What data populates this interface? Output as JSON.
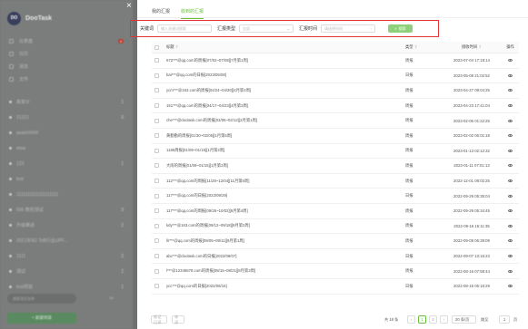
{
  "sidebar": {
    "logo": "DO",
    "title": "DooTask",
    "menu": [
      {
        "label": "仪表盘",
        "badge": "4"
      },
      {
        "label": "日历"
      },
      {
        "label": "消息"
      },
      {
        "label": "文件"
      }
    ],
    "projects": [
      {
        "label": "哀家计",
        "count": "1"
      },
      {
        "label": "21321",
        "count": "0"
      },
      {
        "label": "asas#####",
        "count": ""
      },
      {
        "label": "wwa",
        "count": ""
      },
      {
        "label": "123",
        "count": "1"
      },
      {
        "label": "test",
        "count": ""
      },
      {
        "label": "1111111111111111111",
        "count": ""
      },
      {
        "label": "006 数控测试",
        "count": "3"
      },
      {
        "label": "升级推进",
        "count": "2"
      },
      {
        "label": "2021年5G ToB行业UPF...",
        "count": ""
      },
      {
        "label": "1111",
        "count": "2"
      },
      {
        "label": "测试",
        "count": "2"
      },
      {
        "label": "test项目",
        "count": "1"
      }
    ],
    "search_placeholder": "搜索项目名称",
    "search_count": "13",
    "new_project": "+ 新建项目"
  },
  "close_icon": "×",
  "tabs": [
    {
      "label": "我的汇报",
      "active": false
    },
    {
      "label": "收到的汇报",
      "active": true
    }
  ],
  "filter": {
    "keyword_label": "关键词",
    "keyword_placeholder": "输入关键词搜索",
    "type_label": "汇报类型",
    "type_value": "全部",
    "time_label": "汇报时间",
    "time_placeholder": "请选择时间",
    "search_button": "搜索",
    "accent_color": "#67c23a",
    "highlight_color": "#e23434"
  },
  "table": {
    "headers": {
      "title": "标题",
      "type": "类型",
      "time": "接收时间",
      "op": "操作"
    },
    "rows": [
      {
        "title": "672***@qq.com的周报[07/02~07/08][7月第1周]",
        "type": "周报",
        "time": "2023-07-04 17:18:14"
      },
      {
        "title": "bai***@qq.com的日报[2023/05/08]",
        "type": "日报",
        "time": "2023-05-08 21:02:52"
      },
      {
        "title": "ycm***@163.com的周报[04/24~04/30][4月第4周]",
        "type": "周报",
        "time": "2023-04-27 09:04:25"
      },
      {
        "title": "151***@qq.com的周报[04/17~04/23][4月第3周]",
        "type": "周报",
        "time": "2023-04-23 17:41:04"
      },
      {
        "title": "che***@dootask.com的周报[02/06~02/12][2月第1周]",
        "type": "周报",
        "time": "2023-02-06 01:22:25"
      },
      {
        "title": "黄勤勤的周报[01/30~02/05][1月第5周]",
        "type": "周报",
        "time": "2023-02-02 06:01:18"
      },
      {
        "title": "1185周报[01/09~01/15][1月第2周]",
        "type": "周报",
        "time": "2023-01-13 02:12:32"
      },
      {
        "title": "大雨的周报[01/09~01/15][1月第2周]",
        "type": "周报",
        "time": "2023-01-11 07:01:13"
      },
      {
        "title": "112***@qq.com的周报[11/28~12/04][11月第5周]",
        "type": "周报",
        "time": "2022-12-01 08:02:25"
      },
      {
        "title": "117***@qq.com的日报[2022/09/29]",
        "type": "日报",
        "time": "2022-09-29 05:35:04"
      },
      {
        "title": "117***@qq.com的周报[09/26~10/02][9月第4周]",
        "type": "周报",
        "time": "2022-09-29 05:34:45"
      },
      {
        "title": "kdy***@163.com的周报[09/12~09/18][9月第2周]",
        "type": "周报",
        "time": "2022-09-16 15:11:35"
      },
      {
        "title": "llr***@qq.com的周报[09/05~09/11][9月第1周]",
        "type": "周报",
        "time": "2022-09-08 06:39:09"
      },
      {
        "title": "abc***@dootask.com的日报[2022/09/07]",
        "type": "日报",
        "time": "2022-09-07 13:16:23"
      },
      {
        "title": "l***@12345678.com的周报[08/15~08/21][8月第3周]",
        "type": "周报",
        "time": "2022-08-16 07:58:44"
      },
      {
        "title": "ycc***@qq.com的日报[2022/08/15]",
        "type": "日报",
        "time": "2022-08-15 05:15:29"
      }
    ]
  },
  "footer": {
    "mark_read": "标记已读",
    "mark_unread": "未读",
    "total": "共 18 条",
    "pages": [
      "1",
      "2"
    ],
    "page_size": "20 条/页",
    "jump_label": "跳至",
    "jump_value": "1",
    "jump_unit": "页"
  }
}
